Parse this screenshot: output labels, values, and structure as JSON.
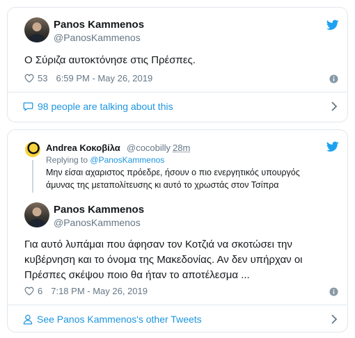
{
  "tweet1": {
    "author_name": "Panos Kammenos",
    "author_handle": "@PanosKammenos",
    "text": "Ο Σύριζα αυτοκτόνησε στις Πρέσπες.",
    "likes": "53",
    "timestamp": "6:59 PM - May 26, 2019",
    "talking_link": "98 people are talking about this"
  },
  "tweet2": {
    "reply": {
      "author_name": "Andrea Κοκοβίλα",
      "author_handle": "@cocobilly",
      "time_ago": "28m",
      "replying_prefix": "Replying to",
      "replying_handle": "@PanosKammenos",
      "text_line1": "Μην είσαι αχαριστος πρόεδρε, ήσουν ο πιο ενεργητικός υπουργός",
      "text_line2": "άμυνας της μεταπολίτευσης κι αυτό το χρωστάς στον Τσίπρα"
    },
    "author_name": "Panos Kammenos",
    "author_handle": "@PanosKammenos",
    "text_line1": "Για αυτό λυπάμαι που άφησαν τον Κοτζιά να σκοτώσει την",
    "text_line2": "κυβέρνηση και το όνομα της Μακεδονίας. Αν δεν υπήρχαν οι",
    "text_line3": "Πρέσπες σκέψου ποιο θα ήταν το αποτέλεσμα ...",
    "likes": "6",
    "timestamp": "7:18 PM - May 26, 2019",
    "other_tweets_link": "See Panos Kammenos's other Tweets"
  },
  "colors": {
    "twitter_blue": "#1da1f2",
    "link_blue": "#1b95e0",
    "muted_gray": "#657786",
    "border": "#e1e8ed"
  }
}
